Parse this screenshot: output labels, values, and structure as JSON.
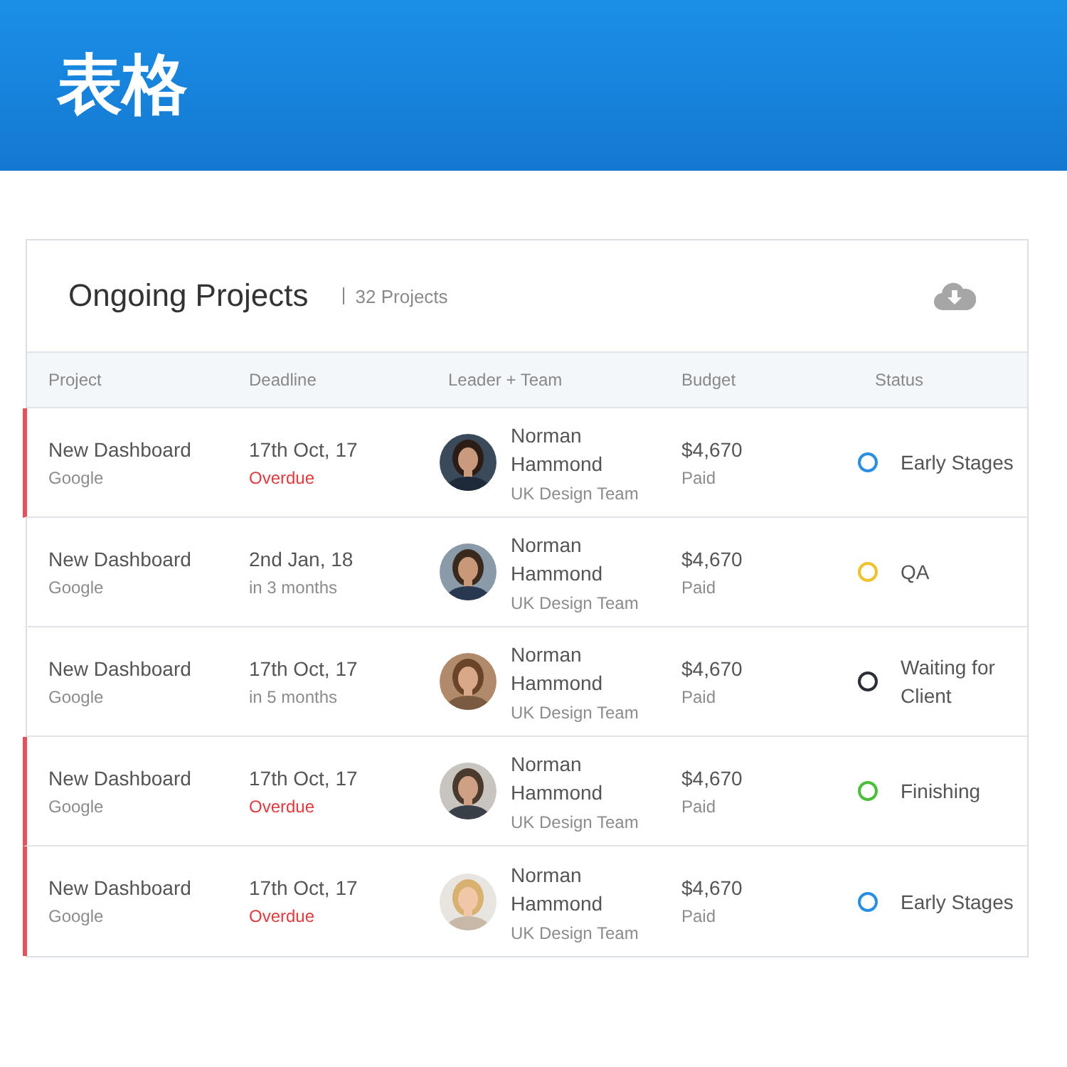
{
  "banner": {
    "title": "表格"
  },
  "card": {
    "title": "Ongoing Projects",
    "count": "32 Projects"
  },
  "table": {
    "columns": [
      "Project",
      "Deadline",
      "Leader + Team",
      "Budget",
      "Status"
    ],
    "rows": [
      {
        "project": "New Dashboard",
        "client": "Google",
        "deadline": "17th Oct, 17",
        "due": "Overdue",
        "overdue": true,
        "leader": "Norman Hammond",
        "team": "UK Design Team",
        "budget": "$4,670",
        "payment": "Paid",
        "status": "Early Stages",
        "color": "#2a8fe0"
      },
      {
        "project": "New Dashboard",
        "client": "Google",
        "deadline": "2nd Jan, 18",
        "due": "in 3 months",
        "overdue": false,
        "leader": "Norman Hammond",
        "team": "UK Design Team",
        "budget": "$4,670",
        "payment": "Paid",
        "status": "QA",
        "color": "#f2c12e"
      },
      {
        "project": "New Dashboard",
        "client": "Google",
        "deadline": "17th Oct, 17",
        "due": "in 5 months",
        "overdue": false,
        "leader": "Norman Hammond",
        "team": "UK Design Team",
        "budget": "$4,670",
        "payment": "Paid",
        "status": "Waiting for Client",
        "color": "#2b2f36"
      },
      {
        "project": "New Dashboard",
        "client": "Google",
        "deadline": "17th Oct, 17",
        "due": "Overdue",
        "overdue": true,
        "leader": "Norman Hammond",
        "team": "UK Design Team",
        "budget": "$4,670",
        "payment": "Paid",
        "status": "Finishing",
        "color": "#4cbf3a"
      },
      {
        "project": "New Dashboard",
        "client": "Google",
        "deadline": "17th Oct, 17",
        "due": "Overdue",
        "overdue": true,
        "leader": "Norman Hammond",
        "team": "UK Design Team",
        "budget": "$4,670",
        "payment": "Paid",
        "status": "Early Stages",
        "color": "#2a8fe0"
      }
    ]
  }
}
